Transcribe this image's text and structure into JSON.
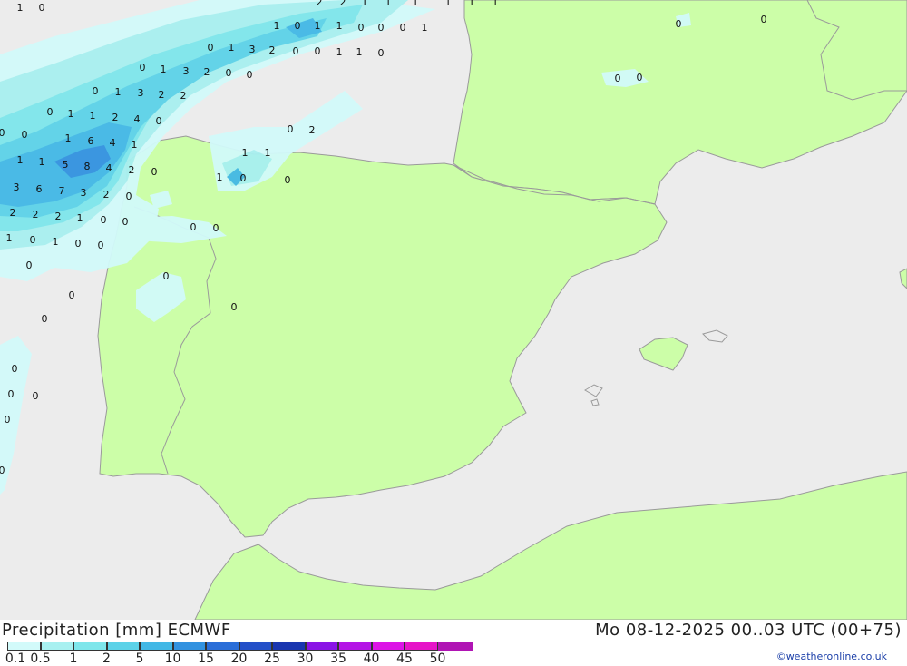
{
  "map": {
    "title": "Precipitation [mm] ECMWF",
    "valid_time": "Mo 08-12-2025 00..03 UTC (00+75)",
    "credit": "©weatheronline.co.uk",
    "colors": {
      "sea": "#ececec",
      "land": "#ccfea8",
      "border": "#9a9a9a"
    }
  },
  "legend": {
    "labels": [
      "0.1",
      "0.5",
      "1",
      "2",
      "5",
      "10",
      "15",
      "20",
      "25",
      "30",
      "35",
      "40",
      "45",
      "50"
    ],
    "colors": [
      "#d2fafa",
      "#a8f0f0",
      "#7ee6eb",
      "#5cd2e8",
      "#42b8e6",
      "#3292e0",
      "#2a6ed8",
      "#2450c8",
      "#1a36b0",
      "#8a14e6",
      "#b414e6",
      "#dc14e6",
      "#e614c8",
      "#b014b4"
    ]
  },
  "precip_values": [
    {
      "text": "1"
    },
    {
      "text": "0"
    },
    {
      "text": "2"
    },
    {
      "text": "2"
    },
    {
      "text": "1"
    },
    {
      "text": "1"
    },
    {
      "text": "1"
    },
    {
      "text": "1"
    },
    {
      "text": "1"
    },
    {
      "text": "1"
    },
    {
      "text": "1"
    },
    {
      "text": "0"
    },
    {
      "text": "1"
    },
    {
      "text": "1"
    },
    {
      "text": "0"
    },
    {
      "text": "0"
    },
    {
      "text": "0"
    },
    {
      "text": "1"
    },
    {
      "text": "0"
    },
    {
      "text": "1"
    },
    {
      "text": "3"
    },
    {
      "text": "2"
    },
    {
      "text": "0"
    },
    {
      "text": "0"
    },
    {
      "text": "1"
    },
    {
      "text": "1"
    },
    {
      "text": "0"
    },
    {
      "text": "0"
    },
    {
      "text": "1"
    },
    {
      "text": "3"
    },
    {
      "text": "2"
    },
    {
      "text": "0"
    },
    {
      "text": "0"
    },
    {
      "text": "0"
    },
    {
      "text": "1"
    },
    {
      "text": "3"
    },
    {
      "text": "2"
    },
    {
      "text": "2"
    },
    {
      "text": "0"
    },
    {
      "text": "1"
    },
    {
      "text": "1"
    },
    {
      "text": "2"
    },
    {
      "text": "4"
    },
    {
      "text": "0"
    },
    {
      "text": "0"
    },
    {
      "text": "0"
    },
    {
      "text": "1"
    },
    {
      "text": "6"
    },
    {
      "text": "4"
    },
    {
      "text": "1"
    },
    {
      "text": "1"
    },
    {
      "text": "1"
    },
    {
      "text": "5"
    },
    {
      "text": "8"
    },
    {
      "text": "4"
    },
    {
      "text": "2"
    },
    {
      "text": "0"
    },
    {
      "text": "3"
    },
    {
      "text": "6"
    },
    {
      "text": "7"
    },
    {
      "text": "3"
    },
    {
      "text": "2"
    },
    {
      "text": "0"
    },
    {
      "text": "2"
    },
    {
      "text": "2"
    },
    {
      "text": "2"
    },
    {
      "text": "1"
    },
    {
      "text": "0"
    },
    {
      "text": "0"
    },
    {
      "text": "1"
    },
    {
      "text": "0"
    },
    {
      "text": "1"
    },
    {
      "text": "0"
    },
    {
      "text": "0"
    },
    {
      "text": "0"
    },
    {
      "text": "0"
    },
    {
      "text": "0"
    },
    {
      "text": "0"
    },
    {
      "text": "0"
    },
    {
      "text": "0"
    },
    {
      "text": "0"
    },
    {
      "text": "1"
    },
    {
      "text": "0"
    },
    {
      "text": "0"
    },
    {
      "text": "2"
    },
    {
      "text": "0"
    },
    {
      "text": "1"
    },
    {
      "text": "1"
    },
    {
      "text": "0"
    },
    {
      "text": "0"
    },
    {
      "text": "0"
    },
    {
      "text": "0"
    },
    {
      "text": "0"
    },
    {
      "text": "0"
    },
    {
      "text": "0"
    },
    {
      "text": "0"
    },
    {
      "text": "0"
    }
  ]
}
